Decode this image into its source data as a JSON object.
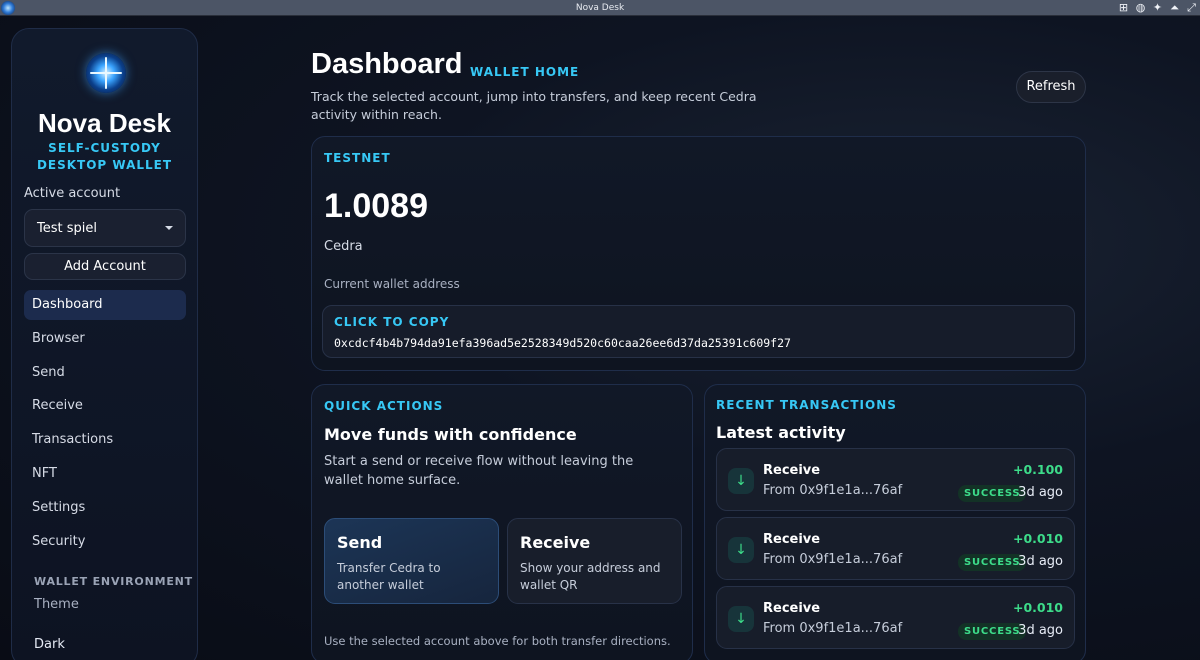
{
  "window": {
    "title": "Nova Desk",
    "icons": [
      "app-logo-icon",
      "tile-windows-icon",
      "web-icon",
      "pin-icon",
      "keep-above-icon",
      "fullscreen-icon"
    ]
  },
  "sidebar": {
    "brand_name": "Nova Desk",
    "brand_tagline": "SELF-CUSTODY DESKTOP WALLET",
    "active_account_label": "Active account",
    "active_account_value": "Test spiel",
    "add_account_label": "Add Account",
    "nav": [
      {
        "label": "Dashboard",
        "active": true
      },
      {
        "label": "Browser",
        "active": false
      },
      {
        "label": "Send",
        "active": false
      },
      {
        "label": "Receive",
        "active": false
      },
      {
        "label": "Transactions",
        "active": false
      },
      {
        "label": "NFT",
        "active": false
      },
      {
        "label": "Settings",
        "active": false
      },
      {
        "label": "Security",
        "active": false
      }
    ],
    "environment_heading": "WALLET ENVIRONMENT",
    "theme_label": "Theme",
    "theme_value": "Dark"
  },
  "header": {
    "title": "Dashboard",
    "subtitle": "WALLET HOME",
    "description": "Track the selected account, jump into transfers, and keep recent Cedra activity within reach.",
    "refresh_label": "Refresh"
  },
  "balance": {
    "network": "TESTNET",
    "amount": "1.0089",
    "unit": "Cedra",
    "address_label": "Current wallet address",
    "copy_label": "CLICK TO COPY",
    "address": "0xcdcf4b4b794da91efa396ad5e2528349d520c60caa26ee6d37da25391c609f27"
  },
  "quick_actions": {
    "eyebrow": "QUICK ACTIONS",
    "heading": "Move funds with confidence",
    "description": "Start a send or receive flow without leaving the wallet home surface.",
    "send_title": "Send",
    "send_desc": "Transfer Cedra to another wallet",
    "receive_title": "Receive",
    "receive_desc": "Show your address and wallet QR",
    "footer": "Use the selected account above for both transfer directions."
  },
  "transactions": {
    "eyebrow": "RECENT TRANSACTIONS",
    "heading": "Latest activity",
    "items": [
      {
        "type": "Receive",
        "from": "From 0x9f1e1a...76af",
        "amount": "+0.100",
        "status": "SUCCESS",
        "time": "3d ago"
      },
      {
        "type": "Receive",
        "from": "From 0x9f1e1a...76af",
        "amount": "+0.010",
        "status": "SUCCESS",
        "time": "3d ago"
      },
      {
        "type": "Receive",
        "from": "From 0x9f1e1a...76af",
        "amount": "+0.010",
        "status": "SUCCESS",
        "time": "3d ago"
      }
    ]
  },
  "colors": {
    "accent": "#37c8f5",
    "success": "#3ddc8a",
    "background": "#0a0e18"
  }
}
